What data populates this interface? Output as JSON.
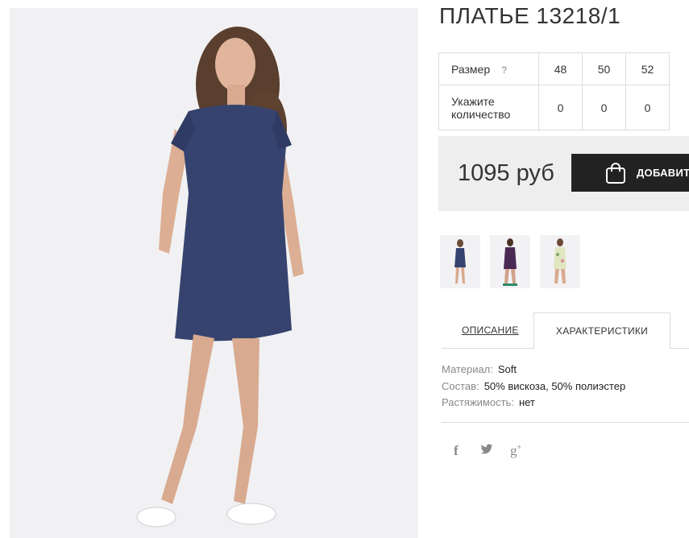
{
  "product": {
    "title": "ПЛАТЬЕ 13218/1"
  },
  "size_table": {
    "size_label": "Размер",
    "help_mark": "?",
    "sizes": [
      "48",
      "50",
      "52"
    ],
    "quantity_label": "Укажите количество",
    "quantities": [
      "0",
      "0",
      "0"
    ]
  },
  "purchase": {
    "price": "1095 руб",
    "add_button_label": "ДОБАВИТЬ"
  },
  "tabs": {
    "description_label": "ОПИСАНИЕ",
    "characteristics_label": "ХАРАКТЕРИСТИКИ",
    "active": "characteristics"
  },
  "characteristics": [
    {
      "key": "Материал:",
      "value": "Soft"
    },
    {
      "key": "Состав:",
      "value": "50% вискоза, 50% полиэстер"
    },
    {
      "key": "Растяжимость:",
      "value": "нет"
    }
  ],
  "social": {
    "facebook_glyph": "f",
    "googleplus_glyph": "g"
  },
  "colors": {
    "dress_navy": "#36436e",
    "button_dark": "#222222",
    "price_box_bg": "#eeeeee"
  }
}
